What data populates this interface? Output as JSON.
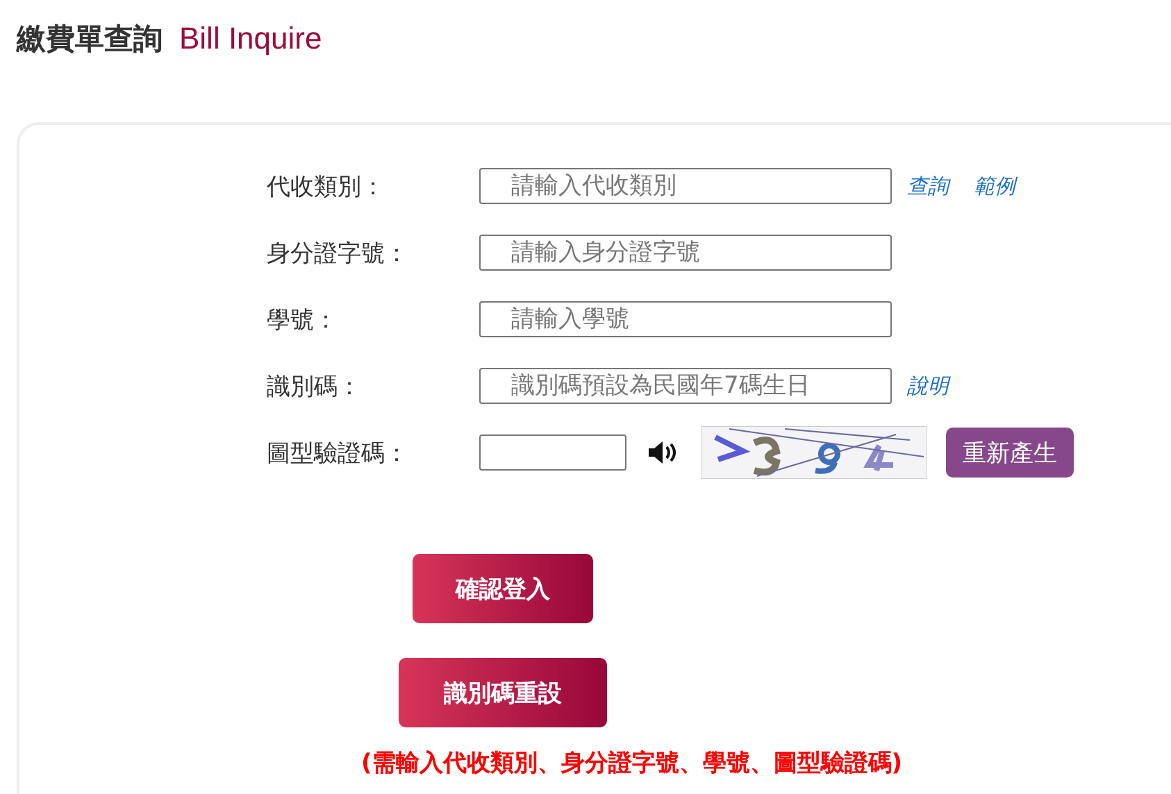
{
  "header": {
    "title": "繳費單查詢",
    "subtitle": "Bill Inquire"
  },
  "fields": [
    {
      "kind": "text",
      "label": "代收類別：",
      "placeholder": "請輸入代收類別",
      "links": [
        "查詢",
        "範例"
      ]
    },
    {
      "kind": "text",
      "label": "身分證字號：",
      "placeholder": "請輸入身分證字號"
    },
    {
      "kind": "text",
      "label": "學號：",
      "placeholder": "請輸入學號"
    },
    {
      "kind": "text",
      "label": "識別碼：",
      "placeholder": "識別碼預設為民國年7碼生日",
      "links": [
        "說明"
      ]
    },
    {
      "kind": "captcha",
      "label": "圖型驗證碼：",
      "refresh_button": "重新產生"
    }
  ],
  "buttons": [
    "確認登入",
    "識別碼重設"
  ],
  "note": "(需輸入代收類別、身分證字號、學號、圖型驗證碼)"
}
